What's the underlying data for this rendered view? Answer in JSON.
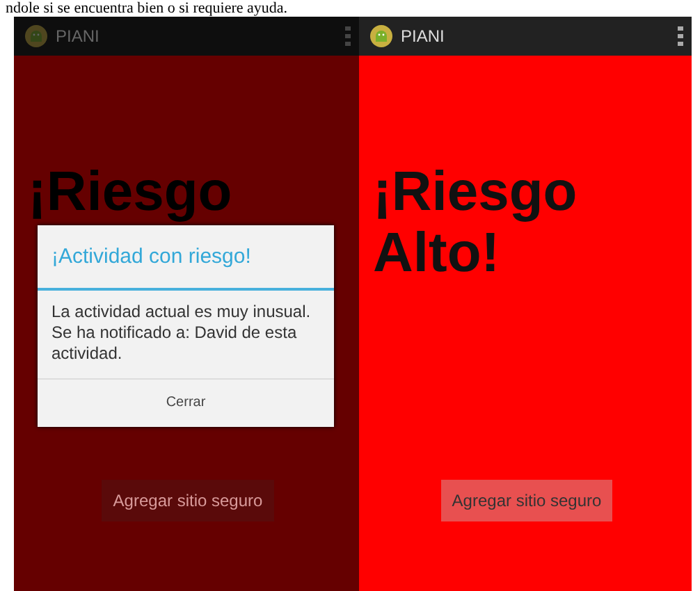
{
  "caption": "ndole si se encuentra bien o si requiere ayuda.",
  "screens": [
    {
      "dimmed": true,
      "app_title": "PIANI",
      "heading": "¡Riesgo",
      "button": "Agregar sitio seguro",
      "dialog": {
        "title": "¡Actividad con riesgo!",
        "message": "La actividad actual es muy inusual. Se ha notificado a: David de esta actividad.",
        "button": "Cerrar"
      }
    },
    {
      "dimmed": false,
      "app_title": "PIANI",
      "heading": "¡Riesgo Alto!",
      "button": "Agregar sitio seguro"
    }
  ]
}
